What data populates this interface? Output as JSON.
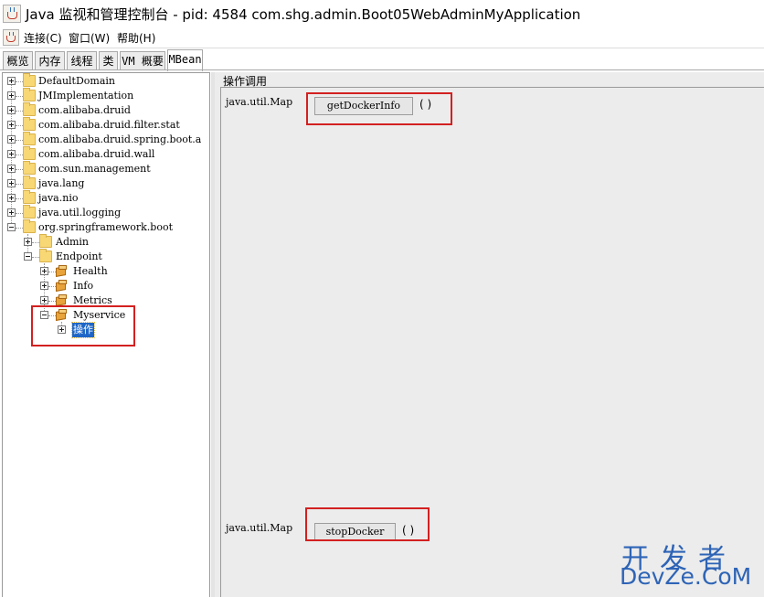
{
  "window": {
    "title": "Java 监视和管理控制台 - pid: 4584 com.shg.admin.Boot05WebAdminMyApplication"
  },
  "menu": [
    {
      "label": "连接(C)"
    },
    {
      "label": "窗口(W)"
    },
    {
      "label": "帮助(H)"
    }
  ],
  "tabs": [
    {
      "label": "概览"
    },
    {
      "label": "内存"
    },
    {
      "label": "线程"
    },
    {
      "label": "类"
    },
    {
      "label": "VM 概要"
    },
    {
      "label": "MBean",
      "active": true
    }
  ],
  "tree": [
    {
      "label": "DefaultDomain",
      "expander": "plus",
      "icon": "folder"
    },
    {
      "label": "JMImplementation",
      "expander": "plus",
      "icon": "folder"
    },
    {
      "label": "com.alibaba.druid",
      "expander": "plus",
      "icon": "folder"
    },
    {
      "label": "com.alibaba.druid.filter.stat",
      "expander": "plus",
      "icon": "folder"
    },
    {
      "label": "com.alibaba.druid.spring.boot.a",
      "expander": "plus",
      "icon": "folder"
    },
    {
      "label": "com.alibaba.druid.wall",
      "expander": "plus",
      "icon": "folder"
    },
    {
      "label": "com.sun.management",
      "expander": "plus",
      "icon": "folder"
    },
    {
      "label": "java.lang",
      "expander": "plus",
      "icon": "folder"
    },
    {
      "label": "java.nio",
      "expander": "plus",
      "icon": "folder"
    },
    {
      "label": "java.util.logging",
      "expander": "plus",
      "icon": "folder"
    },
    {
      "label": "org.springframework.boot",
      "expander": "minus",
      "icon": "folder"
    },
    {
      "label": "Admin",
      "expander": "plus",
      "icon": "folder"
    },
    {
      "label": "Endpoint",
      "expander": "minus",
      "icon": "folder"
    },
    {
      "label": "Health",
      "expander": "plus",
      "icon": "bean"
    },
    {
      "label": "Info",
      "expander": "plus",
      "icon": "bean"
    },
    {
      "label": "Metrics",
      "expander": "plus",
      "icon": "bean"
    },
    {
      "label": "Myservice",
      "expander": "minus",
      "icon": "bean"
    },
    {
      "label": "操作",
      "expander": "plus",
      "icon": "none",
      "selected": true
    }
  ],
  "panel": {
    "title": "操作调用",
    "operations": [
      {
        "return_type": "java.util.Map",
        "name": "getDockerInfo",
        "params": "( )"
      },
      {
        "return_type": "java.util.Map",
        "name": "stopDocker",
        "params": "( )"
      }
    ]
  },
  "watermark": {
    "line1": "开发者",
    "line2": "DevZe.CoM"
  }
}
